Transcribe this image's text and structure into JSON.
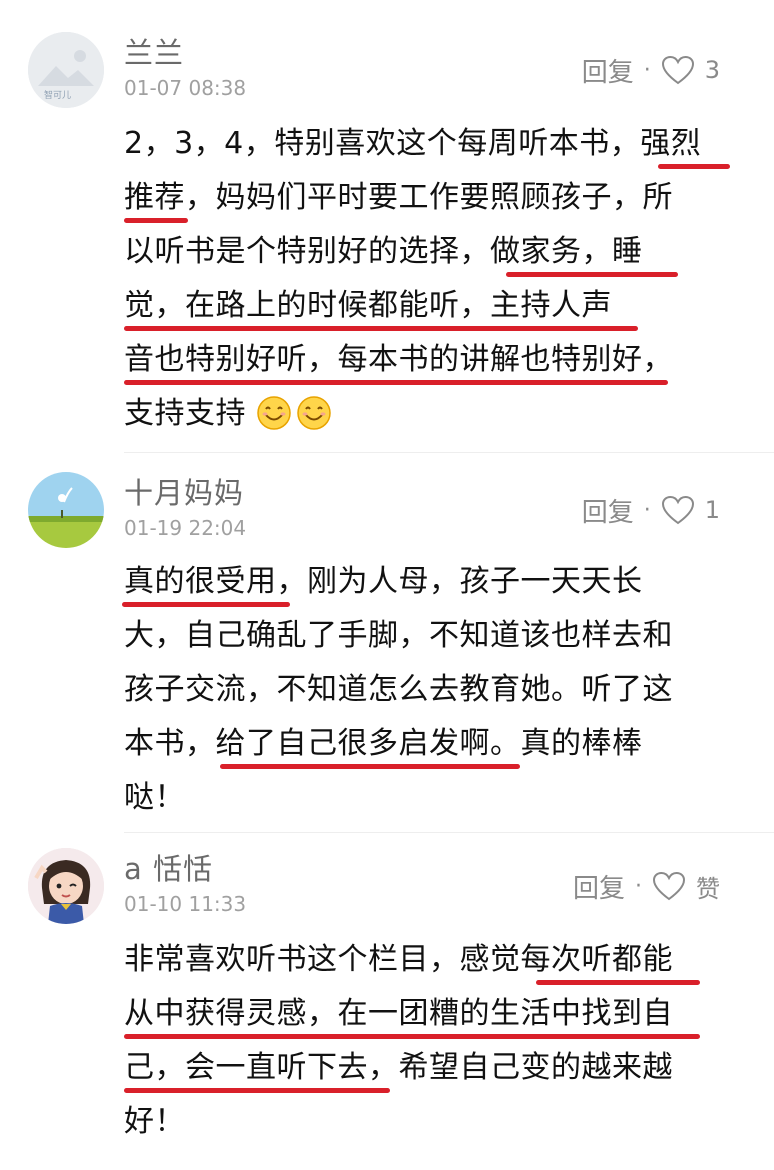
{
  "comments": [
    {
      "username": "兰兰",
      "time": "01-07 08:38",
      "reply": "回复",
      "dot": "·",
      "like_count": "3",
      "avatar_text": "智可儿",
      "lines": [
        "2，3，4，特别喜欢这个每周听本书，强烈",
        "推荐，妈妈们平时要工作要照顾孩子，所",
        "以听书是个特别好的选择，做家务，睡",
        "觉，在路上的时候都能听，主持人声",
        "音也特别好听，每本书的讲解也特别好，",
        "支持支持"
      ]
    },
    {
      "username": "十月妈妈",
      "time": "01-19 22:04",
      "reply": "回复",
      "dot": "·",
      "like_count": "1",
      "lines": [
        "真的很受用，刚为人母，孩子一天天长",
        "大，自己确乱了手脚，不知道该也样去和",
        "孩子交流，不知道怎么去教育她。听了这",
        "本书，给了自己很多启发啊。真的棒棒",
        "哒！"
      ]
    },
    {
      "username": "a  恬恬",
      "time": "01-10 11:33",
      "reply": "回复",
      "dot": "·",
      "like_count": "赞",
      "lines": [
        "非常喜欢听书这个栏目，感觉每次听都能",
        "从中获得灵感，在一团糟的生活中找到自",
        "己，会一直听下去，希望自己变的越来越",
        "好！"
      ]
    }
  ],
  "colors": {
    "underline": "#d9202a",
    "username": "#6a6a6a",
    "time": "#a0a0a0",
    "action": "#8a8a8a"
  },
  "icons": [
    "heart-outline-icon",
    "smile-emoji-icon"
  ]
}
